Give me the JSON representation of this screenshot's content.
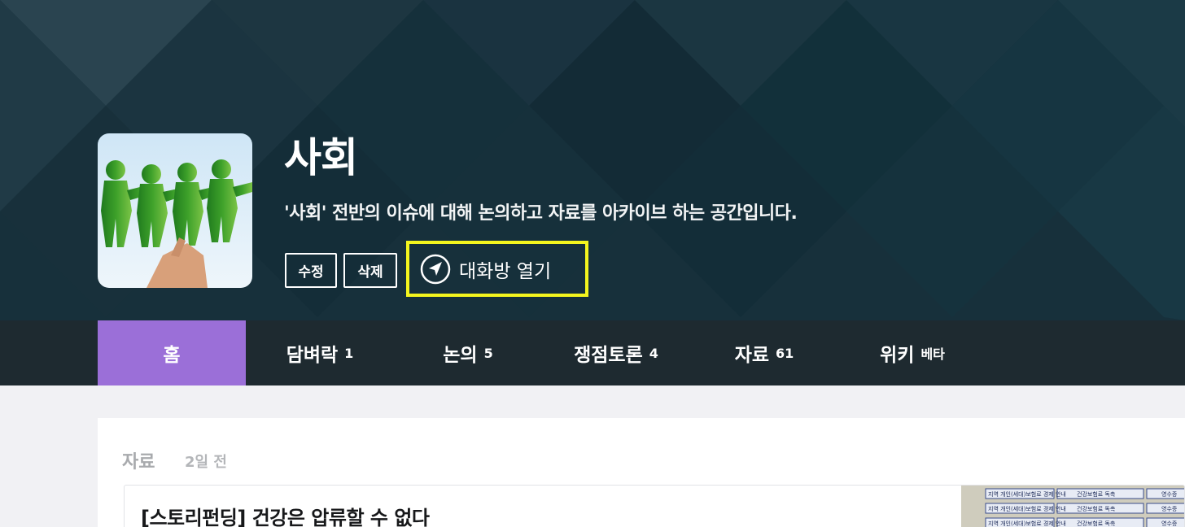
{
  "group": {
    "title": "사회",
    "description": "'사회' 전반의 이슈에 대해 논의하고 자료를 아카이브 하는 공간입니다.",
    "edit_label": "수정",
    "delete_label": "삭제",
    "chat_open_label": "대화방 열기",
    "thumbnail": "paper-people-chain-image"
  },
  "tabs": [
    {
      "label": "홈",
      "count": ""
    },
    {
      "label": "담벼락",
      "count": "1"
    },
    {
      "label": "논의",
      "count": "5"
    },
    {
      "label": "쟁점토론",
      "count": "4"
    },
    {
      "label": "자료",
      "count": "61"
    },
    {
      "label": "위키",
      "count": "베타"
    }
  ],
  "active_tab": "홈",
  "feed": {
    "category": "자료",
    "time": "2일 전",
    "post_title": "[스토리펀딩] 건강은 압류할 수 없다",
    "thumb_rows": [
      {
        "a": "지역 개인(세대)보험료 경제 안내",
        "b": "건강보험료 독촉",
        "c": "영수증"
      },
      {
        "a": "지역 개인(세대)보험료 경제 안내",
        "b": "건강보험료 독촉",
        "c": "영수증"
      },
      {
        "a": "지역 개인(세대)보험료 경제 안내",
        "b": "건강보험료 독촉",
        "c": "영수증"
      }
    ]
  },
  "colors": {
    "hero_bg": "#17303b",
    "tab_bar": "#1e2a30",
    "tab_active": "#9b6fd8",
    "highlight": "#f4f51e"
  },
  "icons": [
    "navigation-arrow-icon"
  ]
}
